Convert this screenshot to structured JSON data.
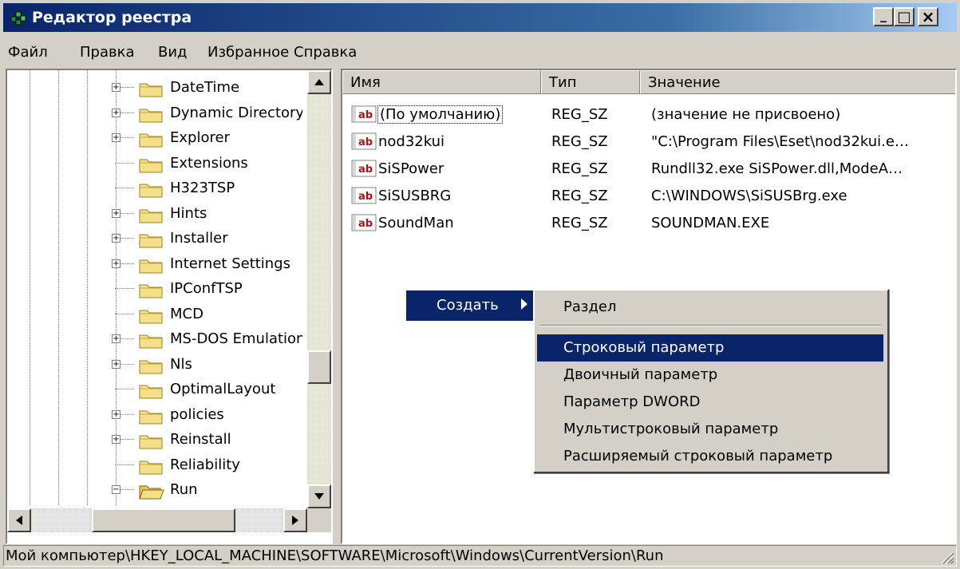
{
  "window": {
    "title": "Редактор реестра",
    "minimize_glyph": "_",
    "maximize_glyph": "□",
    "close_glyph": "×"
  },
  "menu": [
    "Файл",
    "Правка",
    "Вид",
    "Избранное",
    "Справка"
  ],
  "tree": {
    "items": [
      {
        "label": "DateTime",
        "expandable": true
      },
      {
        "label": "Dynamic Directory",
        "expandable": true
      },
      {
        "label": "Explorer",
        "expandable": true
      },
      {
        "label": "Extensions",
        "expandable": false
      },
      {
        "label": "H323TSP",
        "expandable": false
      },
      {
        "label": "Hints",
        "expandable": true
      },
      {
        "label": "Installer",
        "expandable": true
      },
      {
        "label": "Internet Settings",
        "expandable": true
      },
      {
        "label": "IPConfTSP",
        "expandable": false
      },
      {
        "label": "MCD",
        "expandable": false
      },
      {
        "label": "MS-DOS Emulation",
        "expandable": true
      },
      {
        "label": "Nls",
        "expandable": true
      },
      {
        "label": "OptimalLayout",
        "expandable": false
      },
      {
        "label": "policies",
        "expandable": true
      },
      {
        "label": "Reinstall",
        "expandable": true
      },
      {
        "label": "Reliability",
        "expandable": false
      },
      {
        "label": "Run",
        "expandable": true,
        "expanded": true
      }
    ],
    "expander_plus": "+",
    "expander_minus": "−"
  },
  "list": {
    "columns": {
      "name": "Имя",
      "type": "Тип",
      "value": "Значение"
    },
    "icon_text": "ab",
    "rows": [
      {
        "name": "(По умолчанию)",
        "type": "REG_SZ",
        "value": "(значение не присвоено)"
      },
      {
        "name": "nod32kui",
        "type": "REG_SZ",
        "value": "\"C:\\Program Files\\Eset\\nod32kui.e…"
      },
      {
        "name": "SiSPower",
        "type": "REG_SZ",
        "value": "Rundll32.exe SiSPower.dll,ModeA…"
      },
      {
        "name": "SiSUSBRG",
        "type": "REG_SZ",
        "value": "C:\\WINDOWS\\SiSUSBrg.exe"
      },
      {
        "name": "SoundMan",
        "type": "REG_SZ",
        "value": "SOUNDMAN.EXE"
      }
    ]
  },
  "context_menu": {
    "create": "Создать",
    "submenu": [
      "Раздел",
      "Строковый параметр",
      "Двоичный параметр",
      "Параметр DWORD",
      "Мультистроковый параметр",
      "Расширяемый строковый параметр"
    ],
    "selected": "Строковый параметр"
  },
  "statusbar": {
    "path": "Мой компьютер\\HKEY_LOCAL_MACHINE\\SOFTWARE\\Microsoft\\Windows\\CurrentVersion\\Run"
  },
  "colors": {
    "selection": "#0a246a",
    "face": "#d4d0c8",
    "folder": "#f5e08a",
    "ab_icon": "#a01818"
  }
}
